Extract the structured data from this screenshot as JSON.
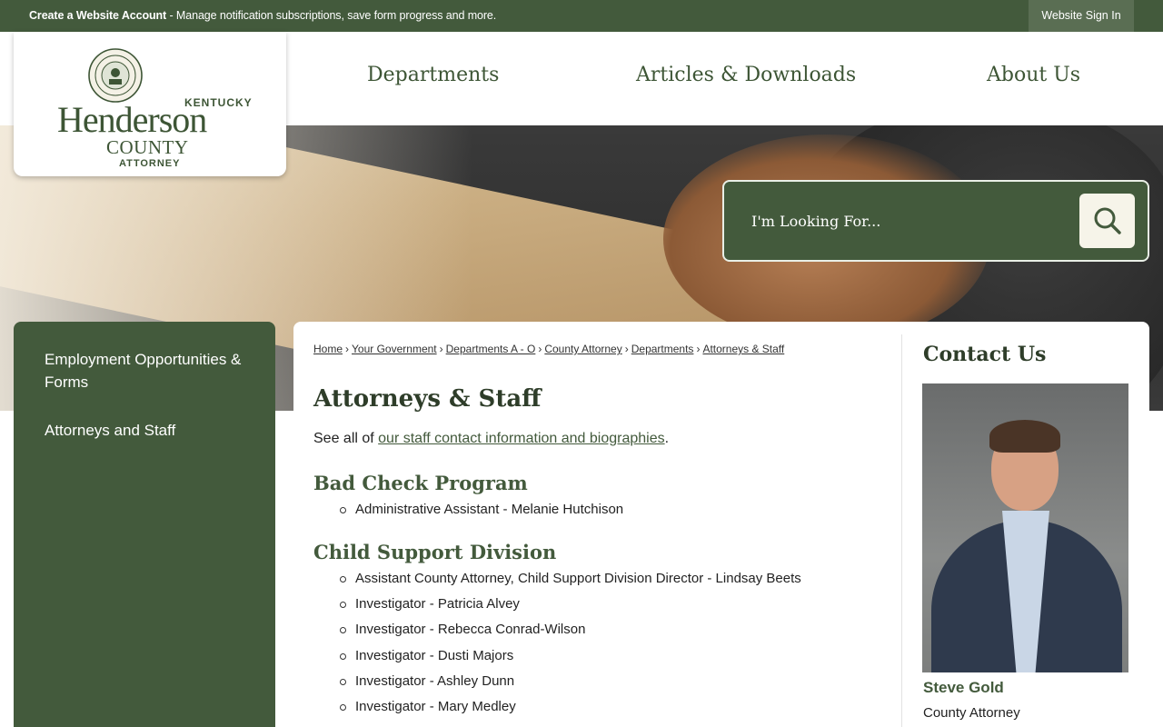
{
  "colors": {
    "brand_green": "#435a3c",
    "signin_bg": "#5a6e53",
    "search_button_bg": "#f6f4e9"
  },
  "topbar": {
    "account_link": "Create a Website Account",
    "account_desc": " - Manage notification subscriptions, save form progress and more.",
    "signin_label": "Website Sign In"
  },
  "logo": {
    "state": "KENTUCKY",
    "name": "Henderson",
    "county": "COUNTY",
    "office": "ATTORNEY",
    "seal_icon": "county-seal"
  },
  "nav": {
    "items": [
      "Departments",
      "Articles & Downloads",
      "About Us"
    ]
  },
  "search": {
    "placeholder": "I'm Looking For...",
    "icon": "search-icon"
  },
  "sidebar": {
    "items": [
      "Employment Opportunities & Forms",
      "Attorneys and Staff"
    ]
  },
  "breadcrumb": {
    "items": [
      "Home",
      "Your Government",
      "Departments A - O",
      "County Attorney",
      "Departments",
      "Attorneys & Staff"
    ],
    "separator": "›"
  },
  "main": {
    "title": "Attorneys & Staff",
    "intro_prefix": "See all of ",
    "intro_link": "our staff contact information and biographies",
    "intro_suffix": ".",
    "sections": [
      {
        "heading": "Bad Check Program",
        "items": [
          "Administrative Assistant - Melanie Hutchison"
        ]
      },
      {
        "heading": "Child Support Division",
        "items": [
          "Assistant County Attorney, Child Support Division Director - Lindsay Beets",
          "Investigator - Patricia Alvey",
          "Investigator - Rebecca Conrad-Wilson",
          "Investigator - Dusti Majors",
          "Investigator - Ashley Dunn",
          "Investigator - Mary Medley"
        ]
      }
    ]
  },
  "contact": {
    "heading": "Contact Us",
    "name": "Steve Gold",
    "role": "County Attorney"
  }
}
